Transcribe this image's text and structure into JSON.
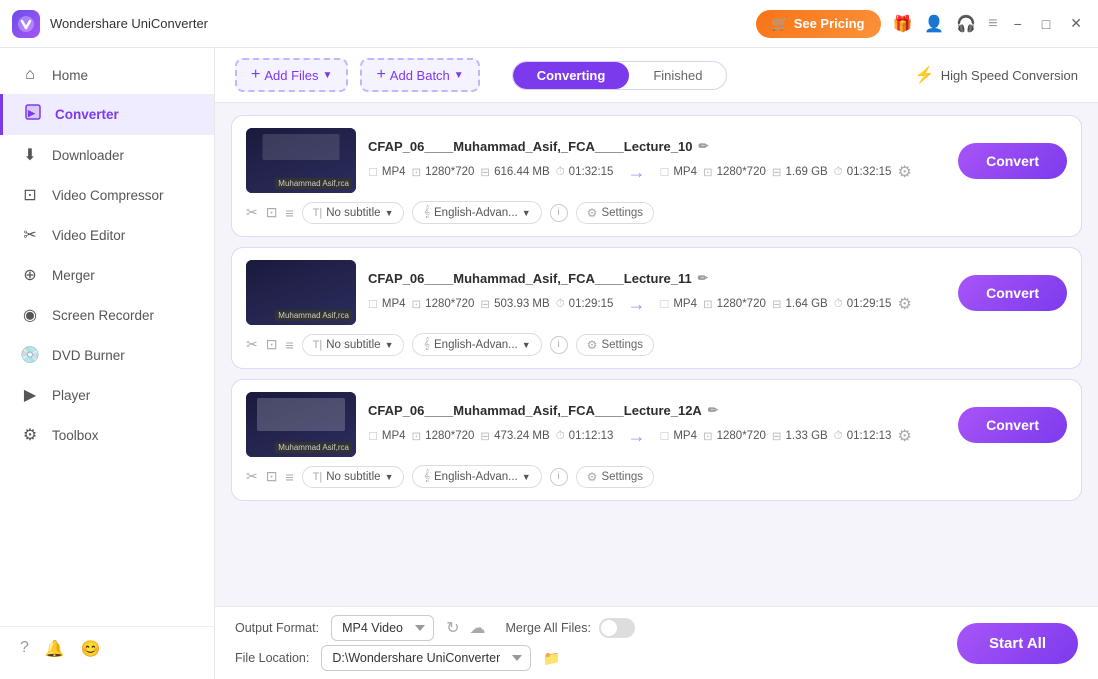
{
  "app": {
    "logo": "W",
    "title": "Wondershare UniConverter"
  },
  "titlebar": {
    "see_pricing": "See Pricing",
    "gift_icon": "🎁",
    "minimize": "−",
    "maximize": "□",
    "close": "✕"
  },
  "sidebar": {
    "items": [
      {
        "id": "home",
        "label": "Home",
        "icon": "⌂"
      },
      {
        "id": "converter",
        "label": "Converter",
        "icon": "⏺",
        "active": true
      },
      {
        "id": "downloader",
        "label": "Downloader",
        "icon": "⬇"
      },
      {
        "id": "video-compressor",
        "label": "Video Compressor",
        "icon": "⊡"
      },
      {
        "id": "video-editor",
        "label": "Video Editor",
        "icon": "✂"
      },
      {
        "id": "merger",
        "label": "Merger",
        "icon": "⊕"
      },
      {
        "id": "screen-recorder",
        "label": "Screen Recorder",
        "icon": "◉"
      },
      {
        "id": "dvd-burner",
        "label": "DVD Burner",
        "icon": "💿"
      },
      {
        "id": "player",
        "label": "Player",
        "icon": "▶"
      },
      {
        "id": "toolbox",
        "label": "Toolbox",
        "icon": "⚙"
      }
    ],
    "bottom_icons": [
      "?",
      "🔔",
      "😊"
    ]
  },
  "toolbar": {
    "add_file_label": "Add Files",
    "add_batch_label": "Add Batch",
    "tab_converting": "Converting",
    "tab_finished": "Finished",
    "high_speed": "High Speed Conversion",
    "active_tab": "converting"
  },
  "files": [
    {
      "id": 1,
      "name": "CFAP_06____Muhammad_Asif,_FCA____Lecture_10",
      "src_format": "MP4",
      "src_resolution": "1280*720",
      "src_size": "616.44 MB",
      "src_duration": "01:32:15",
      "dst_format": "MP4",
      "dst_resolution": "1280*720",
      "dst_size": "1.69 GB",
      "dst_duration": "01:32:15",
      "subtitle": "No subtitle",
      "language": "English-Advan..."
    },
    {
      "id": 2,
      "name": "CFAP_06____Muhammad_Asif,_FCA____Lecture_11",
      "src_format": "MP4",
      "src_resolution": "1280*720",
      "src_size": "503.93 MB",
      "src_duration": "01:29:15",
      "dst_format": "MP4",
      "dst_resolution": "1280*720",
      "dst_size": "1.64 GB",
      "dst_duration": "01:29:15",
      "subtitle": "No subtitle",
      "language": "English-Advan..."
    },
    {
      "id": 3,
      "name": "CFAP_06____Muhammad_Asif,_FCA____Lecture_12A",
      "src_format": "MP4",
      "src_resolution": "1280*720",
      "src_size": "473.24 MB",
      "src_duration": "01:12:13",
      "dst_format": "MP4",
      "dst_resolution": "1280*720",
      "dst_size": "1.33 GB",
      "dst_duration": "01:12:13",
      "subtitle": "No subtitle",
      "language": "English-Advan..."
    }
  ],
  "convert_btn_label": "Convert",
  "settings_label": "Settings",
  "bottom": {
    "output_format_label": "Output Format:",
    "output_format_value": "MP4 Video",
    "file_location_label": "File Location:",
    "file_location_value": "D:\\Wondershare UniConverter",
    "merge_label": "Merge All Files:",
    "start_all_label": "Start All"
  }
}
